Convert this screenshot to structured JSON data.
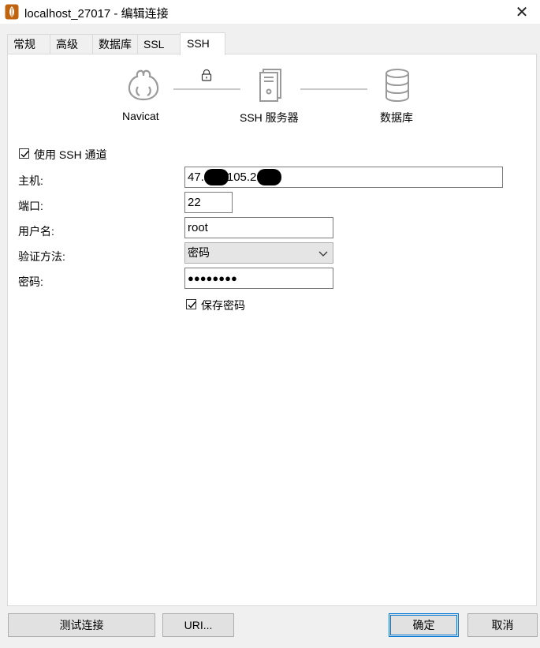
{
  "window": {
    "title": "localhost_27017 - 编辑连接",
    "close_glyph": "✕"
  },
  "tabs": [
    {
      "label": "常规"
    },
    {
      "label": "高级"
    },
    {
      "label": "数据库"
    },
    {
      "label": "SSL"
    },
    {
      "label": "SSH",
      "active": true
    }
  ],
  "diagram": {
    "client_label": "Navicat",
    "server_label": "SSH 服务器",
    "db_label": "数据库"
  },
  "use_ssh": {
    "label": "使用 SSH 通道",
    "checked": true
  },
  "form": {
    "host": {
      "label": "主机:",
      "value_start": "47.",
      "value_mid": "105.2"
    },
    "port": {
      "label": "端口:",
      "value": "22"
    },
    "username": {
      "label": "用户名:",
      "value": "root"
    },
    "auth_method": {
      "label": "验证方法:",
      "value": "密码"
    },
    "password": {
      "label": "密码:",
      "value": "●●●●●●●●"
    }
  },
  "save_password": {
    "label": "保存密码",
    "checked": true
  },
  "buttons": {
    "test": "测试连接",
    "uri": "URI...",
    "ok": "确定",
    "cancel": "取消"
  },
  "colors": {
    "accent": "#0078d7",
    "dialog_bg": "#f0f0f0",
    "icon_gray": "#9a9a9a",
    "app_icon": "#c0630f"
  }
}
